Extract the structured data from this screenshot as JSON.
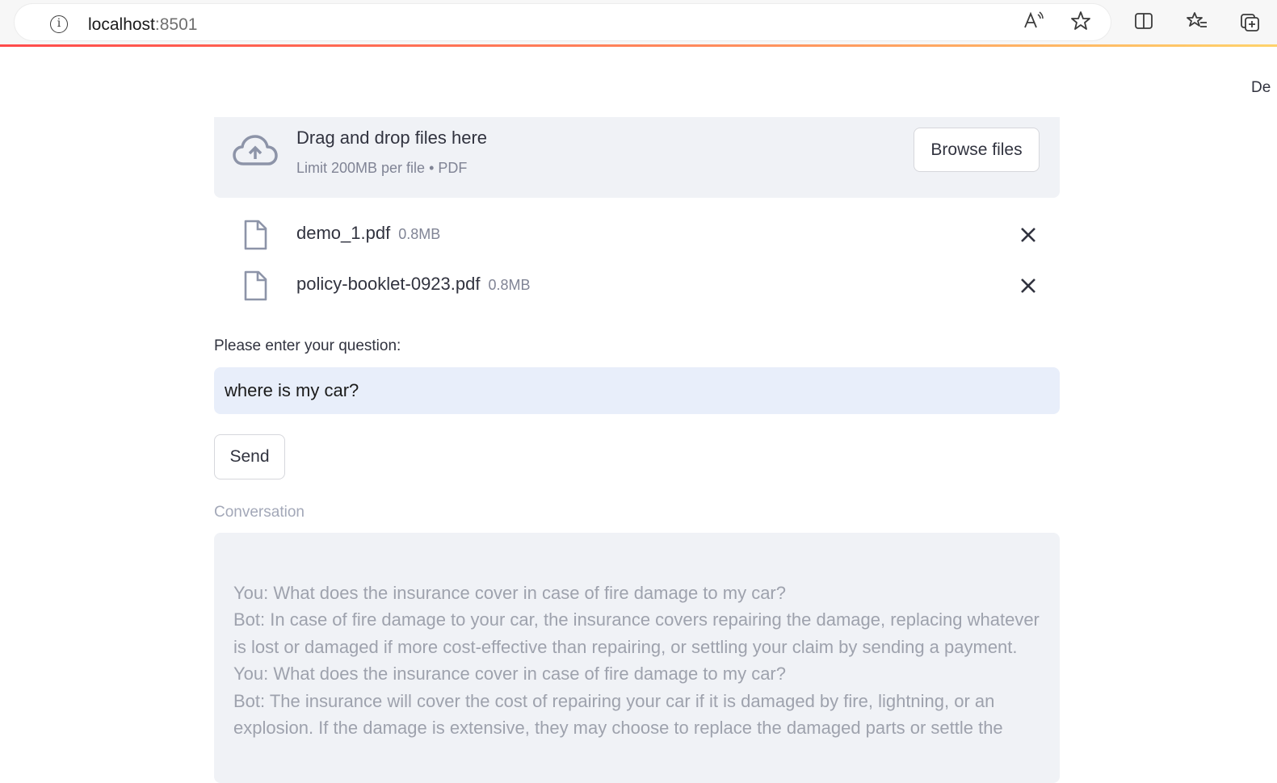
{
  "browser": {
    "url_host": "localhost",
    "url_port": ":8501"
  },
  "header": {
    "deploy_text": "De"
  },
  "uploader": {
    "title": "Drag and drop files here",
    "subtitle": "Limit 200MB per file • PDF",
    "browse_label": "Browse files",
    "files": [
      {
        "name": "demo_1.pdf",
        "size": "0.8MB"
      },
      {
        "name": "policy-booklet-0923.pdf",
        "size": "0.8MB"
      }
    ]
  },
  "question": {
    "label": "Please enter your question:",
    "value": "where is my car?"
  },
  "send_label": "Send",
  "conversation": {
    "label": "Conversation",
    "lines": [
      "You: What does the insurance cover in case of fire damage to my car?",
      "Bot: In case of fire damage to your car, the insurance covers repairing the damage, replacing whatever is lost or damaged if more cost-effective than repairing, or settling your claim by sending a payment.",
      "You: What does the insurance cover in case of fire damage to my car?",
      "Bot: The insurance will cover the cost of repairing your car if it is damaged by fire, lightning, or an explosion. If the damage is extensive, they may choose to replace the damaged parts or settle the"
    ]
  },
  "colors": {
    "accent": "#ff4b4b",
    "dropzone_bg": "#f0f2f6",
    "input_bg": "#e8eefa"
  }
}
